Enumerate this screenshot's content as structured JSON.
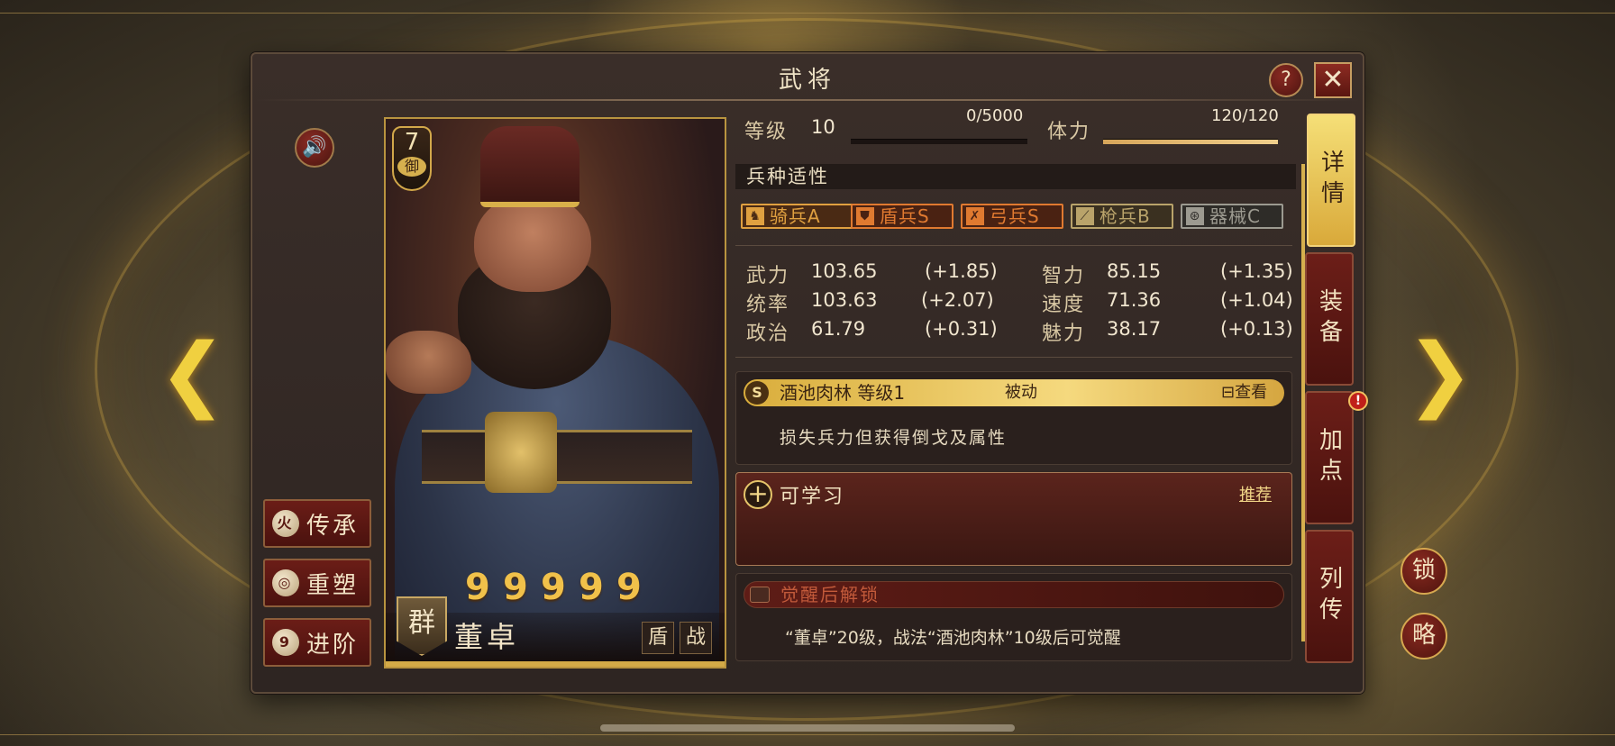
{
  "window": {
    "title": "武将"
  },
  "buttons": {
    "help": "?",
    "close": "✕",
    "sound": "🔊"
  },
  "left_actions": [
    {
      "label": "传承",
      "icon": "fire-icon",
      "glyph": "火"
    },
    {
      "label": "重塑",
      "icon": "reshape-icon",
      "glyph": "◎"
    },
    {
      "label": "进阶",
      "icon": "advance-icon",
      "glyph": "9"
    }
  ],
  "hero": {
    "stars": "7",
    "type_badge": "御",
    "faction": "群",
    "name": "董卓",
    "tags": [
      "盾",
      "战"
    ],
    "coins": [
      "9",
      "9",
      "9",
      "9",
      "9"
    ]
  },
  "level": {
    "label": "等级",
    "value": "10",
    "exp": "0/5000",
    "exp_fraction": 0.0
  },
  "stamina": {
    "label": "体力",
    "value": "120/120",
    "fraction": 1.0
  },
  "troop_section": {
    "title": "兵种适性"
  },
  "troops": [
    {
      "label": "骑兵A",
      "icon": "cavalry-icon",
      "glyph": "♞",
      "color": "#e0a040",
      "bg": "#4a2a14"
    },
    {
      "label": "盾兵S",
      "icon": "shield-icon",
      "glyph": "⛊",
      "color": "#e07a30",
      "bg": "#4a2212"
    },
    {
      "label": "弓兵S",
      "icon": "bow-icon",
      "glyph": "✗",
      "color": "#e07a30",
      "bg": "#4a2212"
    },
    {
      "label": "枪兵B",
      "icon": "spear-icon",
      "glyph": "⟋",
      "color": "#b9a36a",
      "bg": "#3a3020"
    },
    {
      "label": "器械C",
      "icon": "siege-icon",
      "glyph": "⊛",
      "color": "#9c9a90",
      "bg": "#2e2c28"
    }
  ],
  "attributes": [
    {
      "label": "武力",
      "value": "103.65",
      "bonus": "(+1.85)"
    },
    {
      "label": "智力",
      "value": "85.15",
      "bonus": "(+1.35)"
    },
    {
      "label": "统率",
      "value": "103.63",
      "bonus": "(+2.07)"
    },
    {
      "label": "速度",
      "value": "71.36",
      "bonus": "(+1.04)"
    },
    {
      "label": "政治",
      "value": "61.79",
      "bonus": "(+0.31)"
    },
    {
      "label": "魅力",
      "value": "38.17",
      "bonus": "(+0.13)"
    }
  ],
  "skill": {
    "grade": "S",
    "name": "酒池肉林 等级1",
    "kind": "被动",
    "view": "查看",
    "description": "损失兵力但获得倒戈及属性"
  },
  "learnable": {
    "label": "可学习",
    "recommend": "推荐"
  },
  "awaken": {
    "label": "觉醒后解锁",
    "hint": "“董卓”20级，战法“酒池肉林”10级后可觉醒"
  },
  "tabs": [
    {
      "label": "详情",
      "active": true
    },
    {
      "label": "装备",
      "active": false
    },
    {
      "label": "加点",
      "active": false
    },
    {
      "label": "列传",
      "active": false
    }
  ],
  "alert": "!",
  "corner_buttons": {
    "lock": "锁",
    "strategy": "略"
  },
  "nav": {
    "prev": "❮",
    "next": "❯"
  }
}
